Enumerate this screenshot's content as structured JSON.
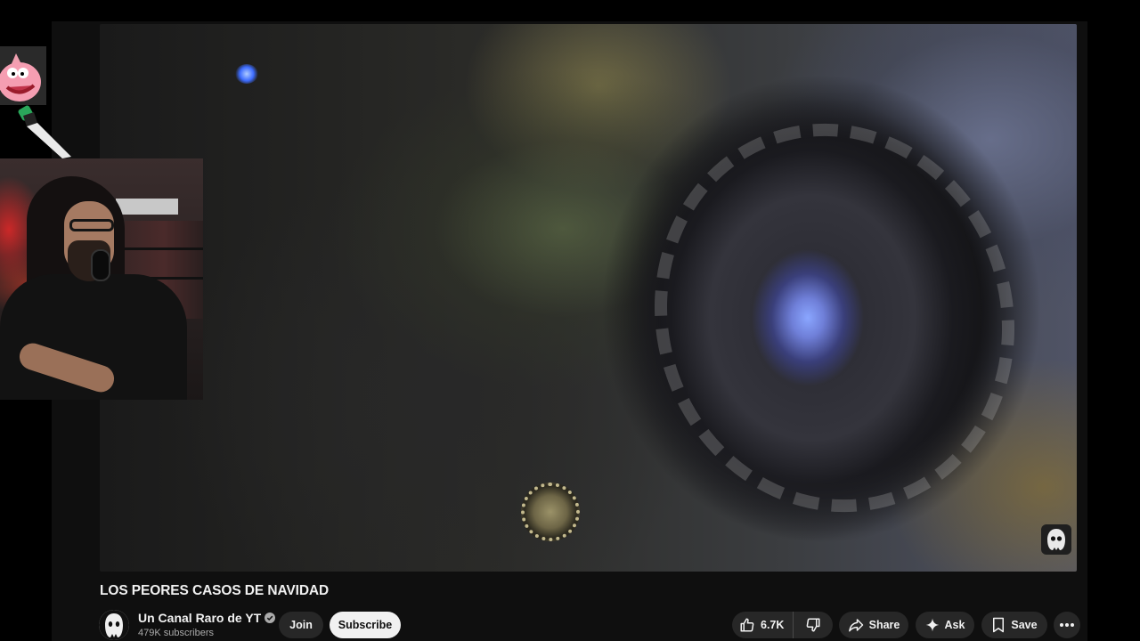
{
  "video": {
    "title": "LOS PEORES CASOS DE NAVIDAD"
  },
  "channel": {
    "name": "Un Canal Raro de YT",
    "subscribers": "479K subscribers",
    "verified": true
  },
  "actions": {
    "join_label": "Join",
    "subscribe_label": "Subscribe",
    "like_count": "6.7K",
    "share_label": "Share",
    "ask_label": "Ask",
    "save_label": "Save"
  },
  "icons": {
    "like": "thumbs-up-icon",
    "dislike": "thumbs-down-icon",
    "share": "share-arrow-icon",
    "ask": "sparkle-icon",
    "save": "bookmark-icon",
    "more": "more-horizontal-icon",
    "verified": "verified-check-icon",
    "watermark": "ghost-watermark-icon"
  },
  "colors": {
    "page_background": "#0f0f0f",
    "button_background": "#272727",
    "subscribe_background": "#f1f1f1",
    "text_primary": "#f1f1f1",
    "text_secondary": "#aaaaaa"
  }
}
